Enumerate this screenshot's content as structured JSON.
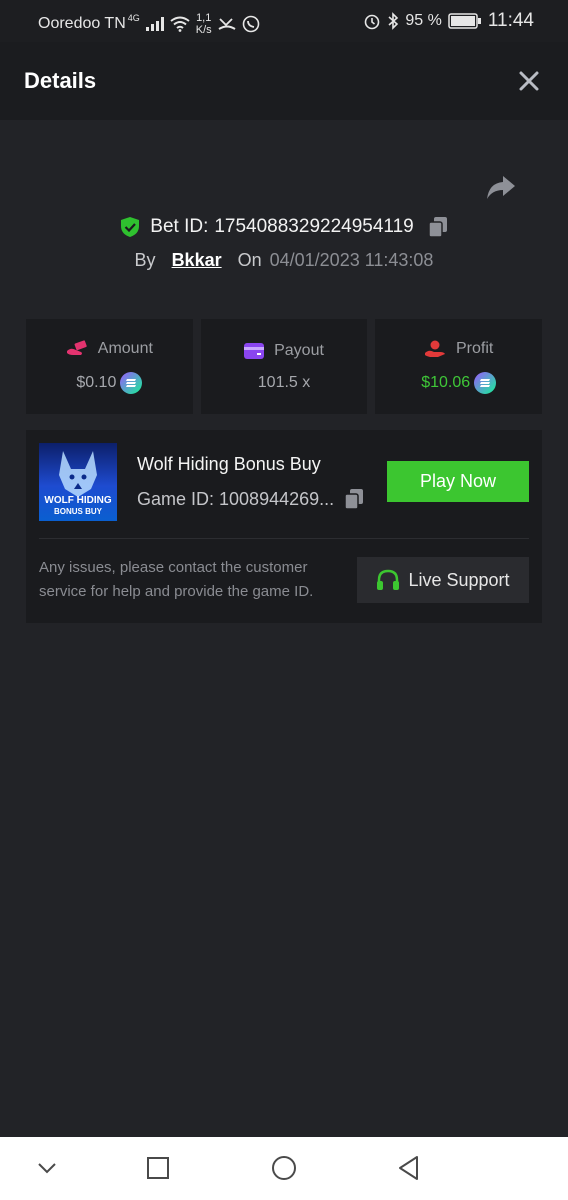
{
  "status_bar": {
    "carrier": "Ooredoo TN",
    "network": "4G",
    "speed_value": "1,1",
    "speed_unit": "K/s",
    "battery_percent": "95 %",
    "time": "11:44"
  },
  "header": {
    "title": "Details"
  },
  "bet": {
    "bet_id_label": "Bet ID:",
    "bet_id": "1754088329224954119",
    "by_label": "By",
    "user": "Bkkar",
    "on_label": "On",
    "date": "04/01/2023 11:43:08"
  },
  "stats": [
    {
      "label": "Amount",
      "value": "$0.10",
      "icon": "money-hand-icon",
      "color": "#e3336f"
    },
    {
      "label": "Payout",
      "value": "101.5 x",
      "icon": "wallet-icon",
      "color": "#8a45f0"
    },
    {
      "label": "Profit",
      "value": "$10.06",
      "icon": "profit-hand-icon",
      "color": "#e23a3a"
    }
  ],
  "game": {
    "thumbnail_text_1": "WOLF HIDING",
    "thumbnail_text_2": "BONUS BUY",
    "name": "Wolf Hiding Bonus Buy",
    "game_id_text": "Game ID: 1008944269...",
    "play_label": "Play Now",
    "notice": "Any issues, please contact the customer service for help and provide the game ID.",
    "support_label": "Live Support"
  },
  "colors": {
    "accent_green": "#3cc630",
    "profit_green": "#3fc738",
    "shield_green": "#2fc12f"
  }
}
